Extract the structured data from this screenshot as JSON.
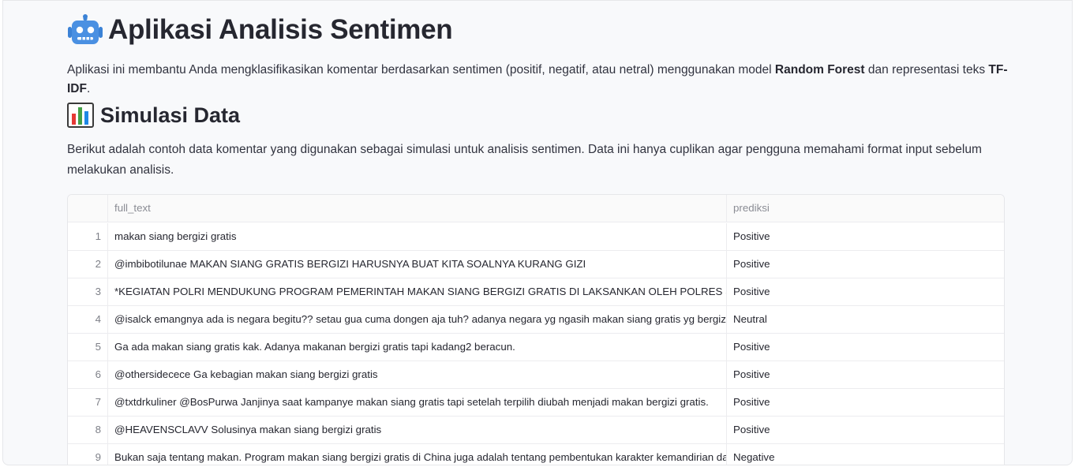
{
  "app": {
    "title": "Aplikasi Analisis Sentimen",
    "intro_pre": "Aplikasi ini membantu Anda mengklasifikasikan komentar berdasarkan sentimen (positif, negatif, atau netral) menggunakan model ",
    "intro_model": "Random Forest",
    "intro_mid": " dan representasi teks ",
    "intro_repr": "TF-IDF",
    "intro_end": "."
  },
  "section": {
    "title": "Simulasi Data",
    "description": "Berikut adalah contoh data komentar yang digunakan sebagai simulasi untuk analisis sentimen. Data ini hanya cuplikan agar pengguna memahami format input sebelum melakukan analisis."
  },
  "table": {
    "columns": [
      "full_text",
      "prediksi"
    ],
    "rows": [
      {
        "idx": "1",
        "text": "makan siang bergizi gratis",
        "pred": "Positive"
      },
      {
        "idx": "2",
        "text": "@imbibotilunae MAKAN SIANG GRATIS BERGIZI HARUSNYA BUAT KITA SOALNYA KURANG GIZI",
        "pred": "Positive"
      },
      {
        "idx": "3",
        "text": "*KEGIATAN POLRI MENDUKUNG PROGRAM PEMERINTAH MAKAN SIANG BERGIZI GRATIS DI LAKSANKAN OLEH POLRES SEKADAU* https",
        "pred": "Positive"
      },
      {
        "idx": "4",
        "text": "@isalck emangnya ada is negara begitu?? setau gua cuma dongen aja tuh? adanya negara yg ngasih makan siang gratis yg bergizi seta",
        "pred": "Neutral"
      },
      {
        "idx": "5",
        "text": "Ga ada makan siang gratis kak. Adanya makanan bergizi gratis tapi kadang2 beracun.",
        "pred": "Positive"
      },
      {
        "idx": "6",
        "text": "@othersidecece Ga kebagian makan siang bergizi gratis",
        "pred": "Positive"
      },
      {
        "idx": "7",
        "text": "@txtdrkuliner @BosPurwa Janjinya saat kampanye makan siang gratis tapi setelah terpilih diubah menjadi makan bergizi gratis.",
        "pred": "Positive"
      },
      {
        "idx": "8",
        "text": "@HEAVENSCLAVV Solusinya makan siang bergizi gratis",
        "pred": "Positive"
      },
      {
        "idx": "9",
        "text": "Bukan saja tentang makan. Program makan siang bergizi gratis di China juga adalah tentang pembentukan karakter kemandirian dan",
        "pred": "Negative"
      }
    ]
  }
}
